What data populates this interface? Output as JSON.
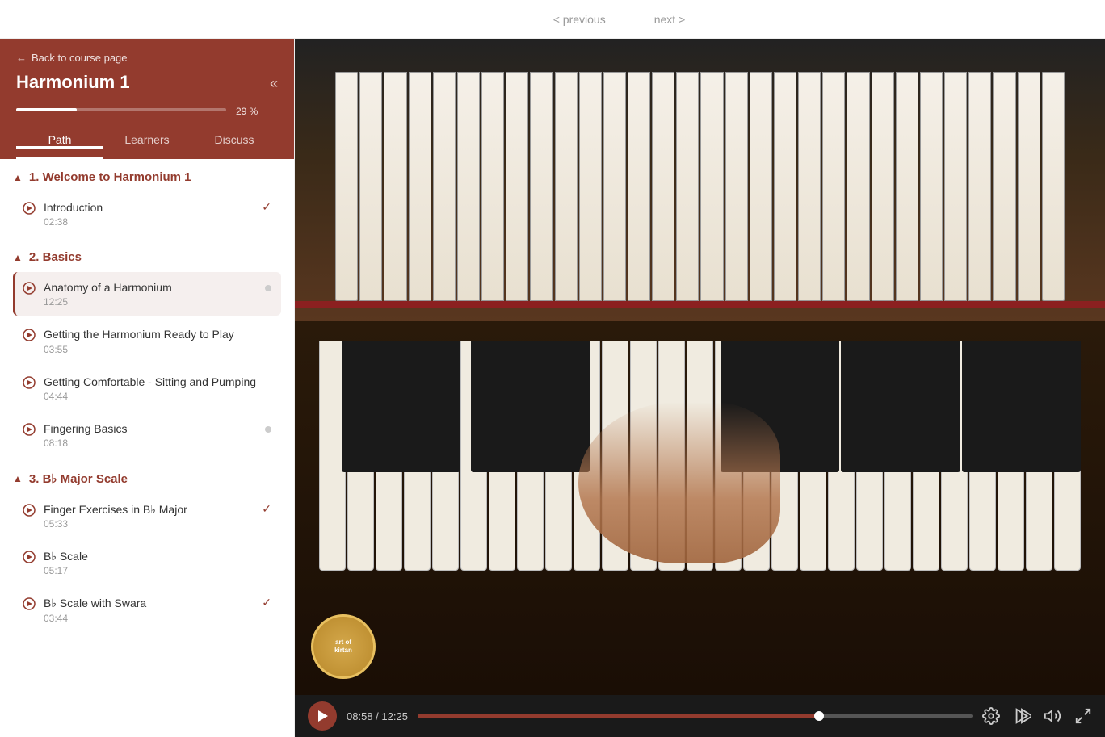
{
  "topbar": {
    "previous_label": "< previous",
    "next_label": "next >"
  },
  "sidebar": {
    "back_label": "Back to course page",
    "course_title": "Harmonium 1",
    "progress_pct": "29 %",
    "progress_value": 29,
    "collapse_icon": "«",
    "tabs": [
      {
        "id": "path",
        "label": "Path",
        "active": true
      },
      {
        "id": "learners",
        "label": "Learners",
        "active": false
      },
      {
        "id": "discuss",
        "label": "Discuss",
        "active": false
      }
    ],
    "sections": [
      {
        "id": "section-1",
        "title": "1. Welcome to Harmonium 1",
        "collapsed": false,
        "lessons": [
          {
            "id": "intro",
            "name": "Introduction",
            "duration": "02:38",
            "completed": true,
            "active": false
          }
        ]
      },
      {
        "id": "section-2",
        "title": "2. Basics",
        "collapsed": false,
        "lessons": [
          {
            "id": "anatomy",
            "name": "Anatomy of a Harmonium",
            "duration": "12:25",
            "completed": false,
            "active": true
          },
          {
            "id": "getready",
            "name": "Getting the Harmonium Ready to Play",
            "duration": "03:55",
            "completed": false,
            "active": false
          },
          {
            "id": "sitting",
            "name": "Getting Comfortable - Sitting and Pumping",
            "duration": "04:44",
            "completed": false,
            "active": false
          },
          {
            "id": "fingering",
            "name": "Fingering Basics",
            "duration": "08:18",
            "completed": false,
            "active": false
          }
        ]
      },
      {
        "id": "section-3",
        "title": "3. B♭ Major Scale",
        "collapsed": false,
        "lessons": [
          {
            "id": "finger-bb",
            "name": "Finger Exercises in B♭ Major",
            "duration": "05:33",
            "completed": true,
            "active": false
          },
          {
            "id": "bb-scale",
            "name": "B♭ Scale",
            "duration": "05:17",
            "completed": false,
            "active": false
          },
          {
            "id": "bb-swara",
            "name": "B♭ Scale with Swara",
            "duration": "03:44",
            "completed": true,
            "active": false
          }
        ]
      }
    ]
  },
  "video": {
    "current_time": "08:58",
    "total_time": "12:25",
    "progress_pct": 72.3,
    "badge_line1": "art of",
    "badge_line2": "kirtan"
  },
  "icons": {
    "back_arrow": "←",
    "play": "▶",
    "settings": "⚙",
    "speed": "⏩",
    "volume": "🔊",
    "fullscreen": "⛶"
  }
}
